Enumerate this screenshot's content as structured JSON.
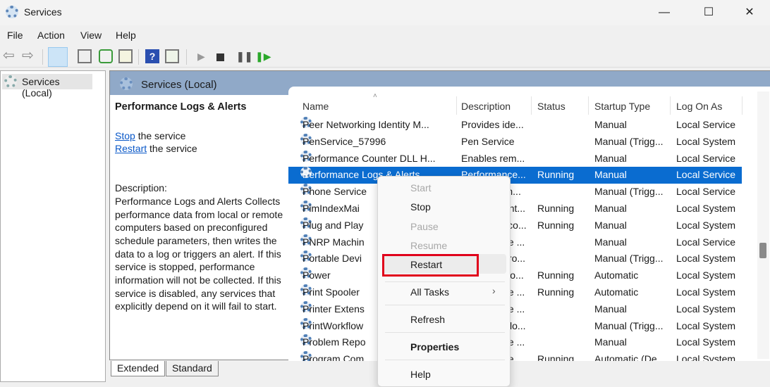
{
  "window": {
    "title": "Services",
    "minimize": "—",
    "maximize": "☐",
    "close": "✕"
  },
  "menu": [
    "File",
    "Action",
    "View",
    "Help"
  ],
  "toolbar": [
    "back-icon",
    "forward-icon",
    "show-hide-tree-icon",
    "properties-icon",
    "refresh-icon",
    "export-icon",
    "help-icon",
    "console-icon",
    "start-icon",
    "stop-icon",
    "pause-icon",
    "resume-icon"
  ],
  "tree": {
    "item": "Services (Local)"
  },
  "header": {
    "title": "Services (Local)"
  },
  "detail": {
    "name": "Performance Logs & Alerts",
    "stop_link": "Stop",
    "stop_rest": " the service",
    "restart_link": "Restart",
    "restart_rest": " the service",
    "desc_label": "Description:",
    "desc": "Performance Logs and Alerts Collects performance data from local or remote computers based on preconfigured schedule parameters, then writes the data to a log or triggers an alert. If this service is stopped, performance information will not be collected. If this service is disabled, any services that explicitly depend on it will fail to start."
  },
  "columns": [
    "Name",
    "Description",
    "Status",
    "Startup Type",
    "Log On As"
  ],
  "rows": [
    [
      "Peer Networking Identity M...",
      "Provides ide...",
      "",
      "Manual",
      "Local Service"
    ],
    [
      "PenService_57996",
      "Pen Service",
      "",
      "Manual (Trigg...",
      "Local System"
    ],
    [
      "Performance Counter DLL H...",
      "Enables rem...",
      "",
      "Manual",
      "Local Service"
    ],
    [
      "Performance Logs & Alerts",
      "Performance...",
      "Running",
      "Manual",
      "Local Service"
    ],
    [
      "Phone Service",
      "Manages th...",
      "",
      "Manual (Trigg...",
      "Local Service"
    ],
    [
      "PimIndexMai",
      "Indexes cont...",
      "Running",
      "Manual",
      "Local System"
    ],
    [
      "Plug and Play",
      "Enables a co...",
      "Running",
      "Manual",
      "Local System"
    ],
    [
      "PNRP Machin",
      "This service ...",
      "",
      "Manual",
      "Local Service"
    ],
    [
      "Portable Devi",
      "Enforces gro...",
      "",
      "Manual (Trigg...",
      "Local System"
    ],
    [
      "Power",
      "Manages po...",
      "Running",
      "Automatic",
      "Local System"
    ],
    [
      "Print Spooler",
      "This service ...",
      "Running",
      "Automatic",
      "Local System"
    ],
    [
      "Printer Extens",
      "This service ...",
      "",
      "Manual",
      "Local System"
    ],
    [
      "PrintWorkflow",
      "Print Workflo...",
      "",
      "Manual (Trigg...",
      "Local System"
    ],
    [
      "Problem Repo",
      "This service ...",
      "",
      "Manual",
      "Local System"
    ],
    [
      "Program Com",
      "This service ...",
      "Running",
      "Automatic (De...",
      "Local System"
    ]
  ],
  "selected_row": 3,
  "tabs": [
    "Extended",
    "Standard"
  ],
  "context_menu": {
    "items": [
      {
        "label": "Start",
        "disabled": true
      },
      {
        "label": "Stop"
      },
      {
        "label": "Pause",
        "disabled": true
      },
      {
        "label": "Resume",
        "disabled": true
      },
      {
        "label": "Restart",
        "highlighted": true
      },
      {
        "label": "All Tasks",
        "submenu": "›"
      },
      {
        "label": "Refresh"
      },
      {
        "label": "Properties",
        "bold": true
      },
      {
        "label": "Help"
      }
    ]
  },
  "colors": {
    "selection": "#0a6cd0",
    "highlight_box": "#e0001b",
    "header": "#90a9c8"
  }
}
